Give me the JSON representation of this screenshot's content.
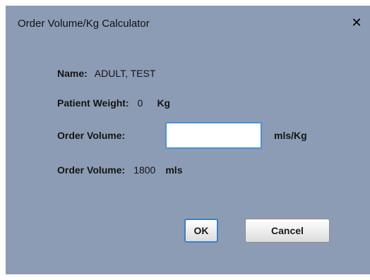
{
  "dialog": {
    "title": "Order Volume/Kg Calculator",
    "close_glyph": "✕"
  },
  "fields": {
    "name_label": "Name:",
    "name_value": "ADULT, TEST",
    "weight_label": "Patient Weight:",
    "weight_value": "0",
    "weight_unit": "Kg",
    "order_volume_label": "Order Volume:",
    "order_volume_input_value": "",
    "order_volume_input_unit": "mls/Kg",
    "order_volume_total_label": "Order Volume:",
    "order_volume_total_value": "1800",
    "order_volume_total_unit": "mls"
  },
  "buttons": {
    "ok_label": "OK",
    "cancel_label": "Cancel"
  },
  "colors": {
    "dialog_background": "#8d9cb5",
    "focus_border": "#4a90d9"
  }
}
